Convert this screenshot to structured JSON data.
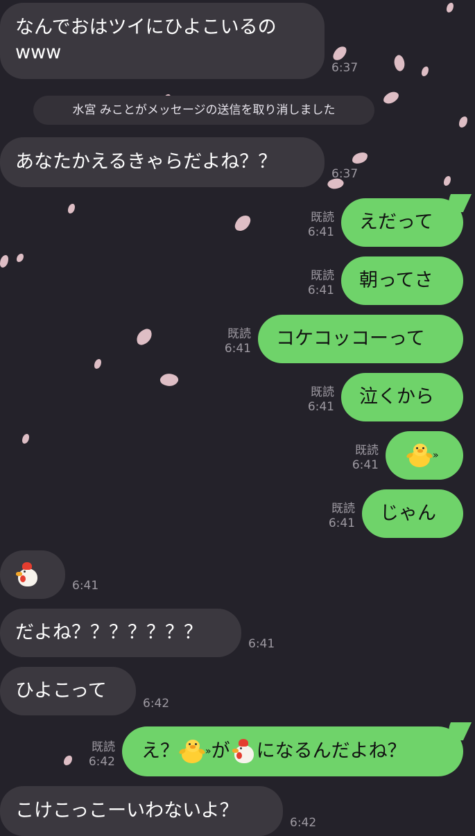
{
  "notice": "水宮 みことがメッセージの送信を取り消しました",
  "read_label": "既読",
  "messages": [
    {
      "line1": "なんでおはツイにひよこいるの",
      "line2": "www",
      "time": "6:37"
    },
    {
      "text": "あなたかえるきゃらだよね？？",
      "time": "6:37"
    },
    {
      "text": "えだって",
      "time": "6:41"
    },
    {
      "text": "朝ってさ",
      "time": "6:41"
    },
    {
      "text": "コケコッコーって",
      "time": "6:41"
    },
    {
      "text": "泣くから",
      "time": "6:41"
    },
    {
      "emoji": "baby-chick",
      "quote": "»",
      "time": "6:41"
    },
    {
      "text": "じゃん",
      "time": "6:41"
    },
    {
      "emoji": "rooster",
      "time": "6:41"
    },
    {
      "text": "だよね？？？？？？？",
      "time": "6:41"
    },
    {
      "text": "ひよこって",
      "time": "6:42"
    },
    {
      "part1": "え？",
      "quote": "»",
      "part2": "が",
      "part3": "になるんだよね？",
      "time": "6:42"
    },
    {
      "text": "こけこっこーいわないよ？",
      "time": "6:42"
    }
  ],
  "colors": {
    "background": "#24222a",
    "incoming_bubble": "#3b383f",
    "outgoing_bubble": "#6fd36a",
    "meta_text": "#9e9aa2",
    "petal": "#f3cfd6"
  }
}
